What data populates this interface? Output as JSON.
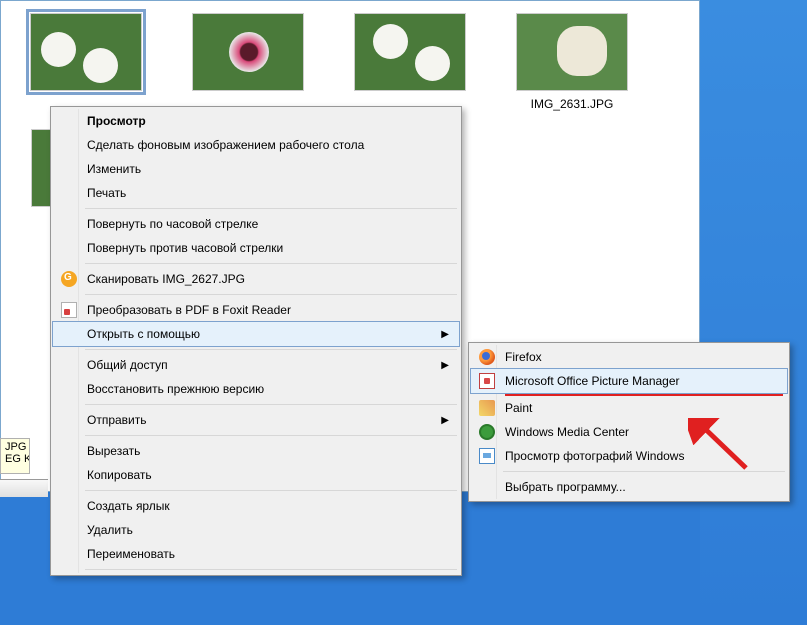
{
  "explorer": {
    "thumbnails": [
      {
        "label": "",
        "selected": true,
        "variant": "white"
      },
      {
        "label": "",
        "selected": false,
        "variant": "pink"
      },
      {
        "label": "",
        "selected": false,
        "variant": "white"
      },
      {
        "label": "IMG_2631.JPG",
        "selected": false,
        "variant": "cream"
      }
    ]
  },
  "tooltip": {
    "line1": "JPG",
    "line2": "EG  K"
  },
  "context_menu": {
    "items": [
      {
        "label": "Просмотр",
        "bold": true
      },
      {
        "label": "Сделать фоновым изображением рабочего стола"
      },
      {
        "label": "Изменить"
      },
      {
        "label": "Печать"
      },
      {
        "separator": true
      },
      {
        "label": "Повернуть по часовой стрелке"
      },
      {
        "label": "Повернуть против часовой стрелки"
      },
      {
        "separator": true
      },
      {
        "label": "Сканировать IMG_2627.JPG",
        "icon": "scan"
      },
      {
        "separator": true
      },
      {
        "label": "Преобразовать в PDF в Foxit Reader",
        "icon": "pdf"
      },
      {
        "label": "Открыть с помощью",
        "submenu": true,
        "highlighted": true
      },
      {
        "separator": true
      },
      {
        "label": "Общий доступ",
        "submenu": true
      },
      {
        "label": "Восстановить прежнюю версию"
      },
      {
        "separator": true
      },
      {
        "label": "Отправить",
        "submenu": true
      },
      {
        "separator": true
      },
      {
        "label": "Вырезать"
      },
      {
        "label": "Копировать"
      },
      {
        "separator": true
      },
      {
        "label": "Создать ярлык"
      },
      {
        "label": "Удалить"
      },
      {
        "label": "Переименовать"
      },
      {
        "separator": true
      }
    ]
  },
  "submenu": {
    "items": [
      {
        "label": "Firefox",
        "icon": "firefox"
      },
      {
        "label": "Microsoft Office Picture Manager",
        "icon": "mspm",
        "highlighted": true,
        "underline": true
      },
      {
        "label": "Paint",
        "icon": "paint"
      },
      {
        "label": "Windows Media Center",
        "icon": "wmc"
      },
      {
        "label": "Просмотр фотографий Windows",
        "icon": "photo"
      },
      {
        "separator": true
      },
      {
        "label": "Выбрать программу..."
      }
    ]
  }
}
